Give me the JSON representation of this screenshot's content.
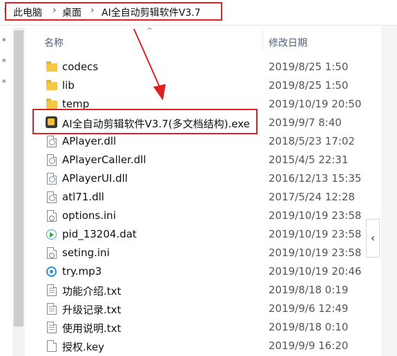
{
  "breadcrumb": [
    "此电脑",
    "桌面",
    "AI全自动剪辑软件V3.7"
  ],
  "columns": {
    "name": "名称",
    "modified": "修改日期"
  },
  "highlight_color": "#e02020",
  "files": [
    {
      "name": "codecs",
      "date": "2019/8/25 1:50",
      "icon": "folder-icon"
    },
    {
      "name": "lib",
      "date": "2019/8/25 1:50",
      "icon": "folder-icon"
    },
    {
      "name": "temp",
      "date": "2019/10/19 20:50",
      "icon": "folder-icon"
    },
    {
      "name": "AI全自动剪辑软件V3.7(多文档结构).exe",
      "date": "2019/9/7 8:40",
      "icon": "exe-icon"
    },
    {
      "name": "APlayer.dll",
      "date": "2018/5/23 17:02",
      "icon": "dll-file-icon"
    },
    {
      "name": "APlayerCaller.dll",
      "date": "2015/4/5 22:31",
      "icon": "dll-file-icon"
    },
    {
      "name": "APlayerUI.dll",
      "date": "2016/12/13 15:35",
      "icon": "dll-file-icon"
    },
    {
      "name": "atl71.dll",
      "date": "2017/5/24 12:28",
      "icon": "dll-file-icon"
    },
    {
      "name": "options.ini",
      "date": "2019/10/19 23:58",
      "icon": "ini-file-icon"
    },
    {
      "name": "pid_13204.dat",
      "date": "2019/10/19 23:58",
      "icon": "media-file-icon"
    },
    {
      "name": "seting.ini",
      "date": "2019/10/19 23:58",
      "icon": "ini-file-icon"
    },
    {
      "name": "try.mp3",
      "date": "2019/10/19 20:46",
      "icon": "mp3-file-icon"
    },
    {
      "name": "功能介绍.txt",
      "date": "2019/8/18 0:19",
      "icon": "text-file-icon"
    },
    {
      "name": "升级记录.txt",
      "date": "2019/9/6 12:49",
      "icon": "text-file-icon"
    },
    {
      "name": "使用说明.txt",
      "date": "2019/8/18 0:10",
      "icon": "text-file-icon"
    },
    {
      "name": "授权.key",
      "date": "2019/9/9 16:20",
      "icon": "key-file-icon"
    }
  ]
}
